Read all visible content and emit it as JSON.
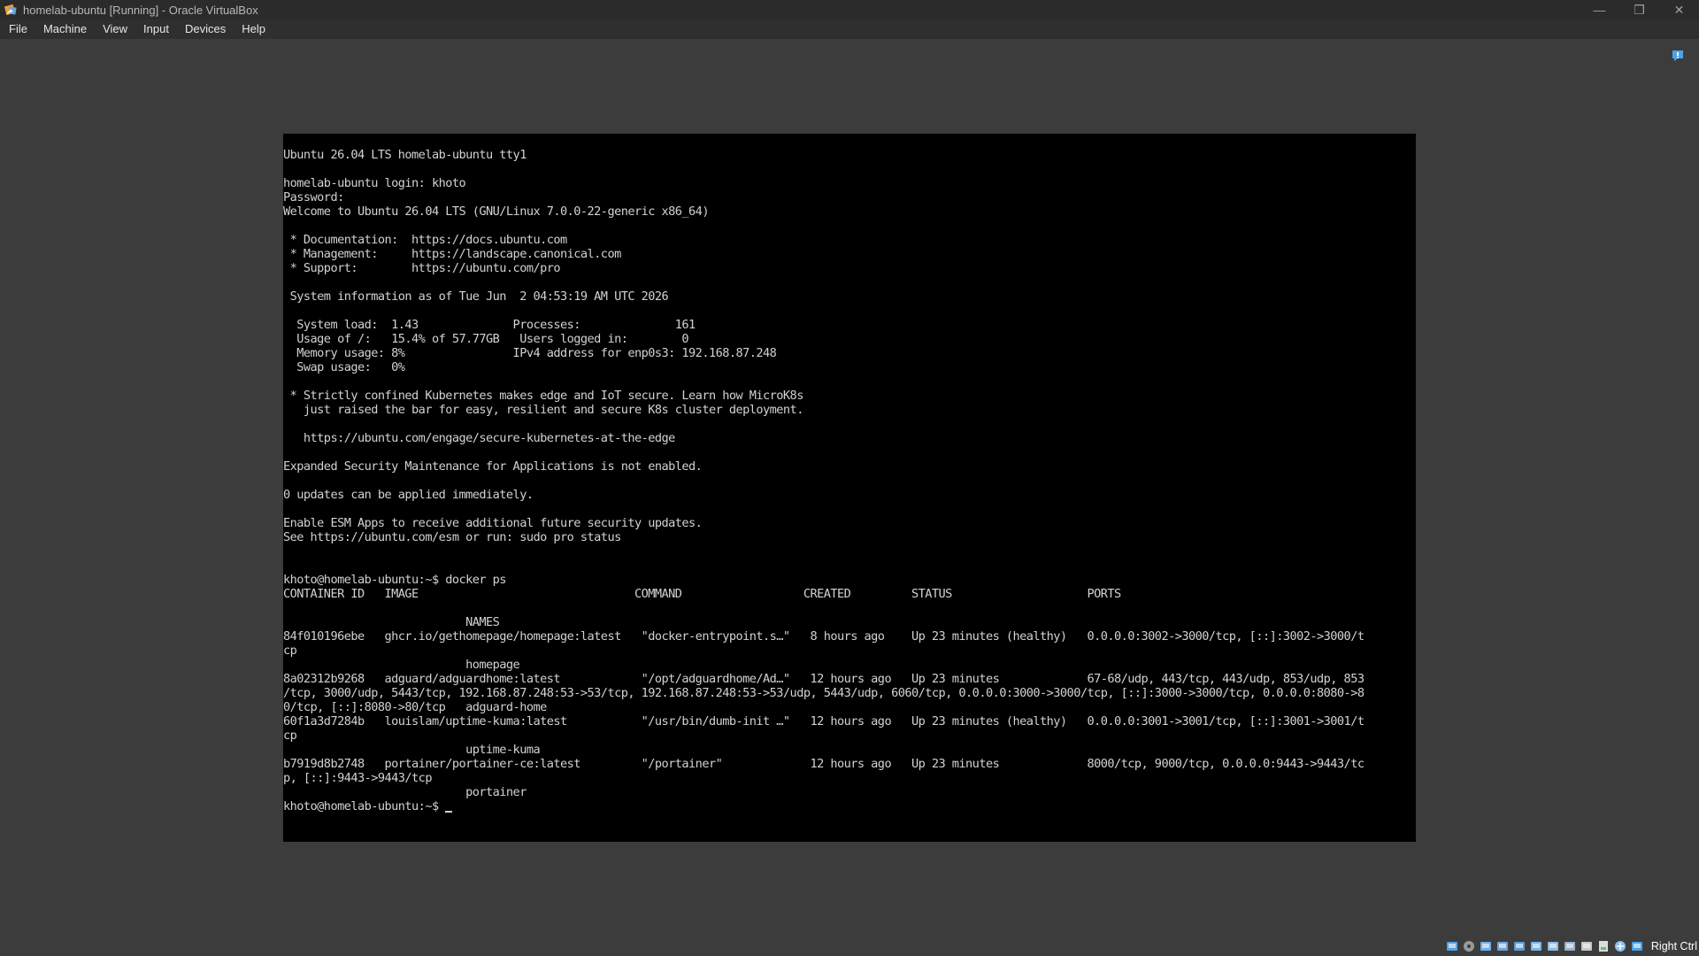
{
  "window": {
    "title": "homelab-ubuntu [Running] - Oracle VirtualBox",
    "controls": {
      "minimize": "—",
      "restore": "❐",
      "close": "✕"
    }
  },
  "menu": {
    "items": [
      "File",
      "Machine",
      "View",
      "Input",
      "Devices",
      "Help"
    ]
  },
  "console": {
    "lines": [
      "Ubuntu 26.04 LTS homelab-ubuntu tty1",
      "",
      "homelab-ubuntu login: khoto",
      "Password:",
      "Welcome to Ubuntu 26.04 LTS (GNU/Linux 7.0.0-22-generic x86_64)",
      "",
      " * Documentation:  https://docs.ubuntu.com",
      " * Management:     https://landscape.canonical.com",
      " * Support:        https://ubuntu.com/pro",
      "",
      " System information as of Tue Jun  2 04:53:19 AM UTC 2026",
      "",
      "  System load:  1.43              Processes:              161",
      "  Usage of /:   15.4% of 57.77GB   Users logged in:        0",
      "  Memory usage: 8%                IPv4 address for enp0s3: 192.168.87.248",
      "  Swap usage:   0%",
      "",
      " * Strictly confined Kubernetes makes edge and IoT secure. Learn how MicroK8s",
      "   just raised the bar for easy, resilient and secure K8s cluster deployment.",
      "",
      "   https://ubuntu.com/engage/secure-kubernetes-at-the-edge",
      "",
      "Expanded Security Maintenance for Applications is not enabled.",
      "",
      "0 updates can be applied immediately.",
      "",
      "Enable ESM Apps to receive additional future security updates.",
      "See https://ubuntu.com/esm or run: sudo pro status",
      "",
      "",
      "khoto@homelab-ubuntu:~$ docker ps",
      "CONTAINER ID   IMAGE                                COMMAND                  CREATED         STATUS                    PORTS",
      "",
      "                           NAMES",
      "84f010196ebe   ghcr.io/gethomepage/homepage:latest   \"docker-entrypoint.s…\"   8 hours ago    Up 23 minutes (healthy)   0.0.0.0:3002->3000/tcp, [::]:3002->3000/t",
      "cp",
      "                           homepage",
      "8a02312b9268   adguard/adguardhome:latest            \"/opt/adguardhome/Ad…\"   12 hours ago   Up 23 minutes             67-68/udp, 443/tcp, 443/udp, 853/udp, 853",
      "/tcp, 3000/udp, 5443/tcp, 192.168.87.248:53->53/tcp, 192.168.87.248:53->53/udp, 5443/udp, 6060/tcp, 0.0.0.0:3000->3000/tcp, [::]:3000->3000/tcp, 0.0.0.0:8080->8",
      "0/tcp, [::]:8080->80/tcp   adguard-home",
      "60f1a3d7284b   louislam/uptime-kuma:latest           \"/usr/bin/dumb-init …\"   12 hours ago   Up 23 minutes (healthy)   0.0.0.0:3001->3001/tcp, [::]:3001->3001/t",
      "cp",
      "                           uptime-kuma",
      "b7919d8b2748   portainer/portainer-ce:latest         \"/portainer\"             12 hours ago   Up 23 minutes             8000/tcp, 9000/tcp, 0.0.0.0:9443->9443/tc",
      "p, [::]:9443->9443/tcp",
      "                           portainer"
    ],
    "prompt": "khoto@homelab-ubuntu:~$ "
  },
  "statusbar": {
    "icons": [
      "hard-disk-icon",
      "optical-drive-icon",
      "audio-icon",
      "network-icon",
      "usb-icon",
      "shared-folders-icon",
      "display-icon",
      "video-capture-icon",
      "recording-icon",
      "cpu-activity-icon",
      "mouse-integration-icon",
      "keyboard-capture-icon"
    ],
    "host_key": "Right Ctrl"
  }
}
